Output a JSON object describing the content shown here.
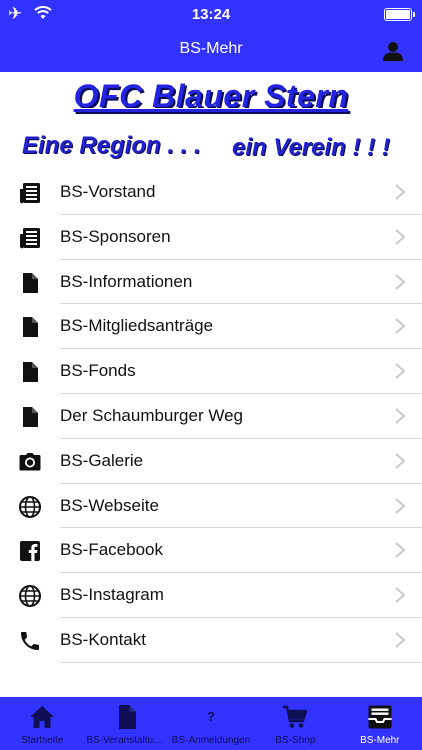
{
  "status_bar": {
    "time": "13:24"
  },
  "navbar": {
    "title": "BS-Mehr",
    "right_icon": "user-icon"
  },
  "banner": {
    "title": "OFC Blauer Stern",
    "slogan_left": "Eine Region . . .",
    "slogan_right": "ein Verein ! ! !"
  },
  "menu": {
    "items": [
      {
        "label": "BS-Vorstand",
        "icon": "newspaper-icon"
      },
      {
        "label": "BS-Sponsoren",
        "icon": "newspaper-icon"
      },
      {
        "label": "BS-Informationen",
        "icon": "document-icon"
      },
      {
        "label": "BS-Mitgliedsanträge",
        "icon": "document-icon"
      },
      {
        "label": "BS-Fonds",
        "icon": "document-icon"
      },
      {
        "label": "Der Schaumburger Weg",
        "icon": "document-icon"
      },
      {
        "label": "BS-Galerie",
        "icon": "camera-icon"
      },
      {
        "label": "BS-Webseite",
        "icon": "globe-icon"
      },
      {
        "label": "BS-Facebook",
        "icon": "facebook-icon"
      },
      {
        "label": "BS-Instagram",
        "icon": "globe-icon"
      },
      {
        "label": "BS-Kontakt",
        "icon": "phone-icon"
      }
    ]
  },
  "tabbar": {
    "active": "BS-Mehr",
    "tabs": [
      {
        "label": "Startseite",
        "icon": "home-icon"
      },
      {
        "label": "BS-Veranstaltungen",
        "icon": "document-icon"
      },
      {
        "label": "BS-Anmeldungen",
        "icon": "question-icon"
      },
      {
        "label": "BS-Shop",
        "icon": "cart-icon"
      },
      {
        "label": "BS-Mehr",
        "icon": "inbox-icon"
      }
    ]
  },
  "colors": {
    "bar": "#3333ff",
    "banner_text": "#2222cc",
    "tab_inactive": "#0f0f55",
    "tab_active": "#ffffff"
  }
}
